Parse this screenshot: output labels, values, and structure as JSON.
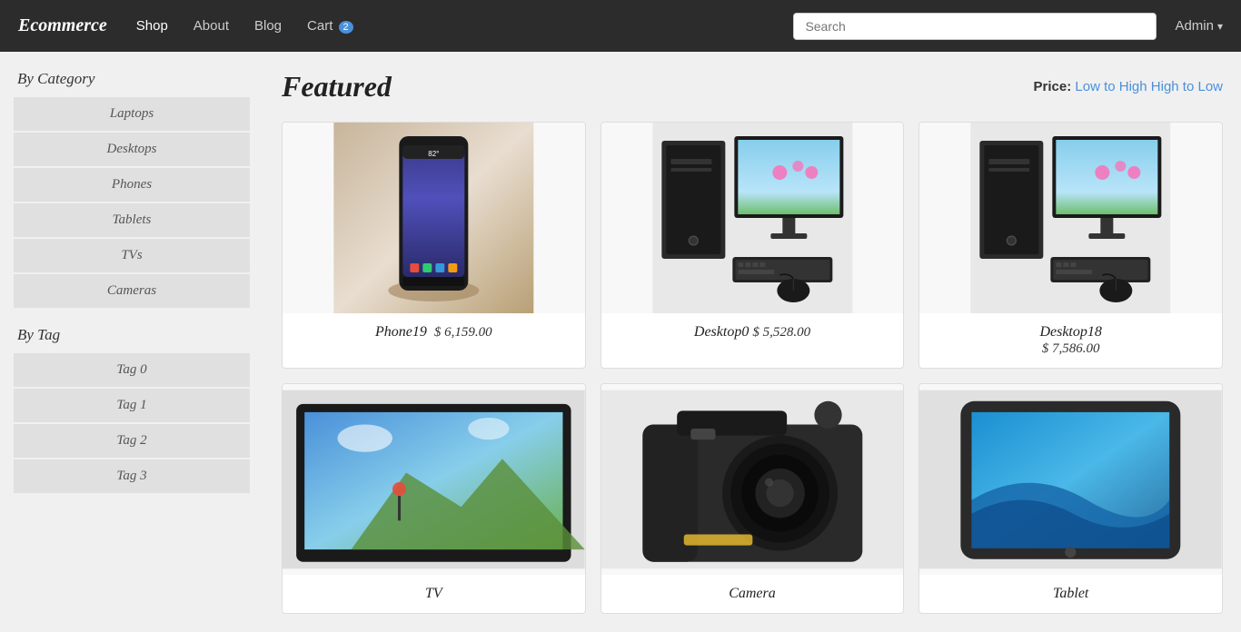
{
  "navbar": {
    "brand": "Ecommerce",
    "links": [
      {
        "label": "Shop",
        "active": true
      },
      {
        "label": "About",
        "active": false
      },
      {
        "label": "Blog",
        "active": false
      },
      {
        "label": "Cart",
        "active": false,
        "badge": "2"
      }
    ],
    "search_placeholder": "Search",
    "admin_label": "Admin"
  },
  "sidebar": {
    "category_title": "By Category",
    "categories": [
      {
        "label": "Laptops"
      },
      {
        "label": "Desktops"
      },
      {
        "label": "Phones"
      },
      {
        "label": "Tablets"
      },
      {
        "label": "TVs"
      },
      {
        "label": "Cameras"
      }
    ],
    "tag_title": "By Tag",
    "tags": [
      {
        "label": "Tag 0"
      },
      {
        "label": "Tag 1"
      },
      {
        "label": "Tag 2"
      },
      {
        "label": "Tag 3"
      }
    ]
  },
  "main": {
    "featured_title": "Featured",
    "price_label": "Price:",
    "price_low_high": "Low to High",
    "price_high_low": "High to Low",
    "products": [
      {
        "name": "Phone19",
        "price": "$ 6,159.00",
        "type": "phone"
      },
      {
        "name": "Desktop0",
        "price": "$ 5,528.00",
        "type": "desktop"
      },
      {
        "name": "Desktop18",
        "price": "$ 7,586.00",
        "type": "desktop"
      },
      {
        "name": "TV",
        "price": "",
        "type": "tv"
      },
      {
        "name": "Camera",
        "price": "",
        "type": "camera"
      },
      {
        "name": "Tablet",
        "price": "",
        "type": "tablet"
      }
    ]
  }
}
